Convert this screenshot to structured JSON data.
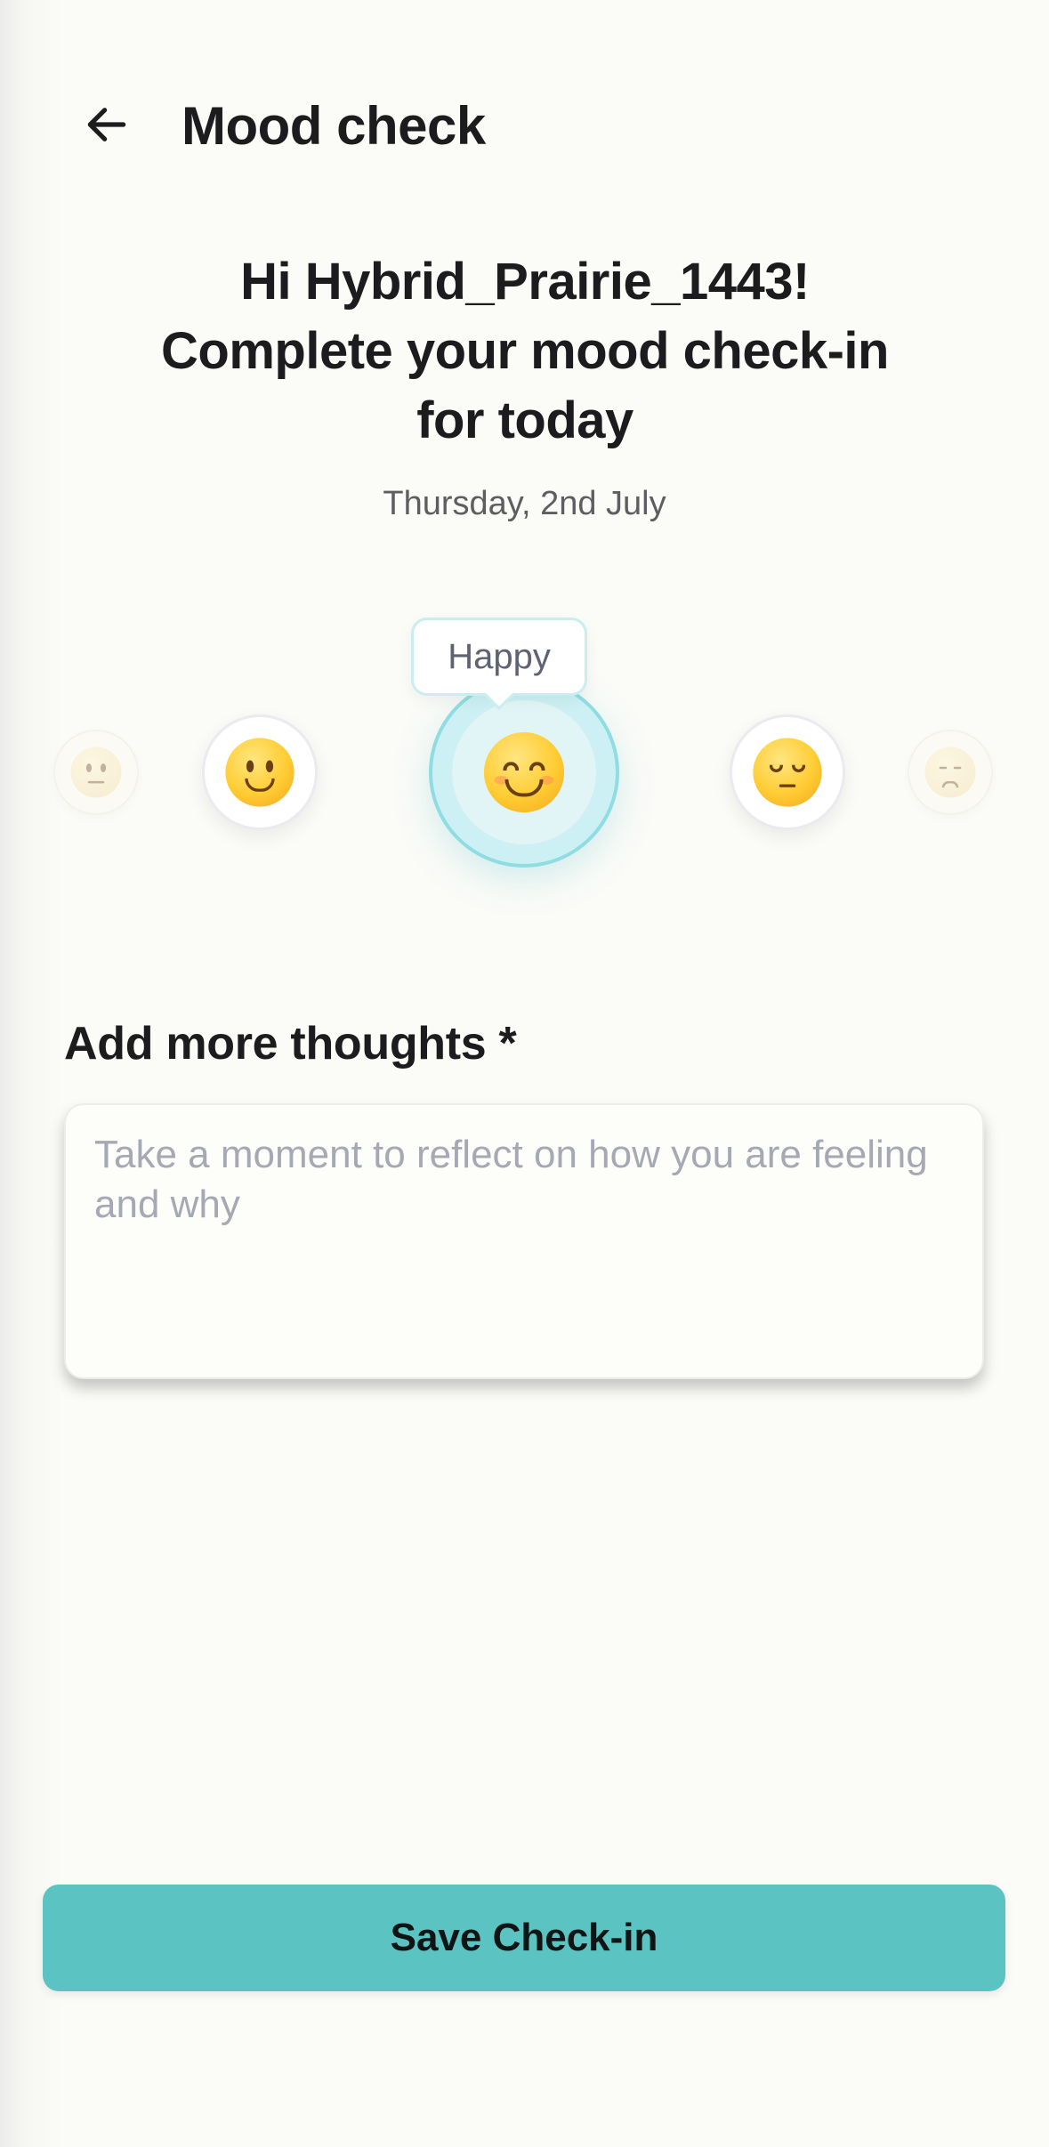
{
  "header": {
    "title": "Mood check",
    "back_icon": "arrow-left-icon"
  },
  "greeting": {
    "line": "Hi Hybrid_Prairie_1443! Complete your mood check-in for today",
    "date": "Thursday, 2nd July"
  },
  "mood_picker": {
    "selected_label": "Happy",
    "moods": [
      {
        "icon": "neutral-face-icon"
      },
      {
        "icon": "slightly-smiling-face-icon"
      },
      {
        "icon": "smiling-face-icon",
        "selected": true
      },
      {
        "icon": "pensive-face-icon"
      },
      {
        "icon": "disappointed-face-icon"
      }
    ],
    "accent_color": "#8fdde2"
  },
  "thoughts": {
    "label": "Add more thoughts *",
    "placeholder": "Take a moment to reflect on how you are feeling and why",
    "value": ""
  },
  "actions": {
    "save_label": "Save Check-in",
    "button_color": "#5bc3c2"
  }
}
